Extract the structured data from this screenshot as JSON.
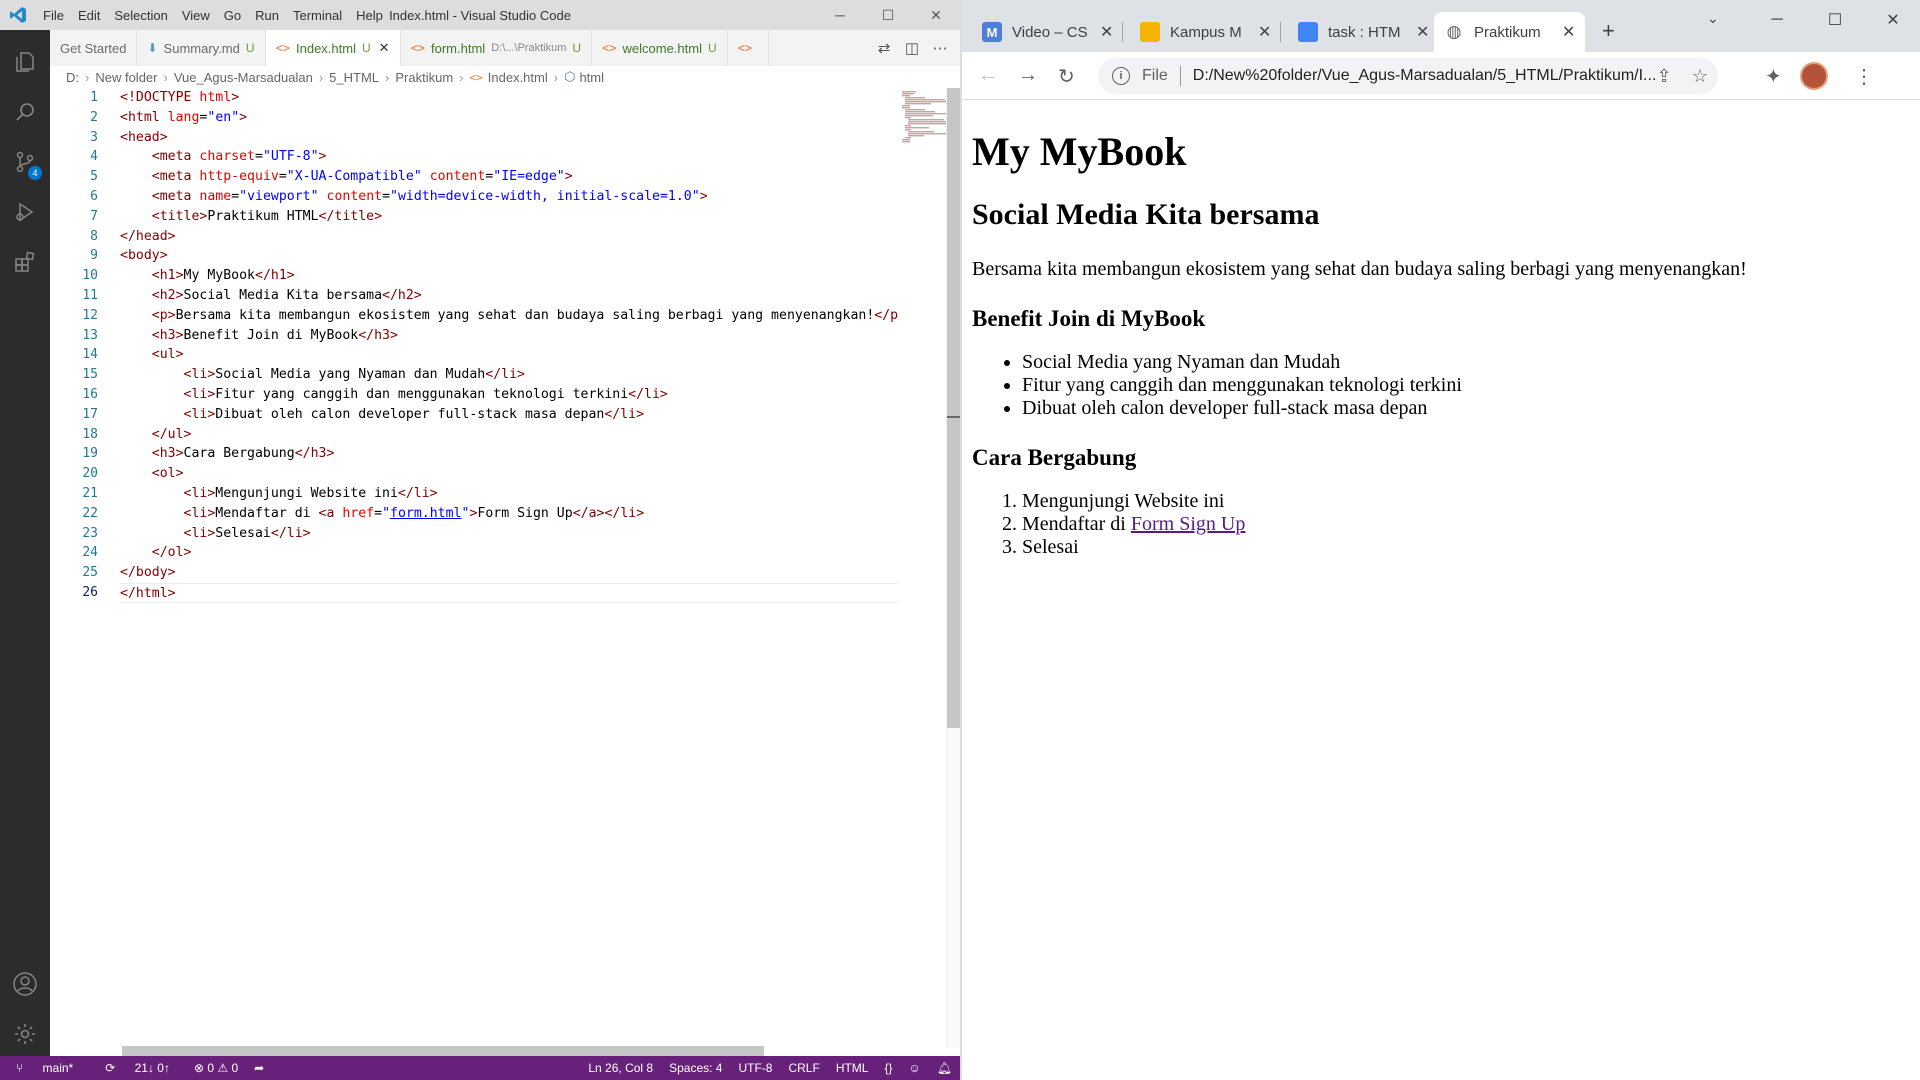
{
  "vscode": {
    "menu": [
      "File",
      "Edit",
      "Selection",
      "View",
      "Go",
      "Run",
      "Terminal",
      "Help"
    ],
    "window_title": "Index.html - Visual Studio Code",
    "tabs": [
      {
        "label": "Get Started",
        "badge": ""
      },
      {
        "label": "Summary.md",
        "badge": "U"
      },
      {
        "label": "Index.html",
        "badge": "U"
      },
      {
        "label": "form.html",
        "path": "D:\\...\\Praktikum",
        "badge": "U"
      },
      {
        "label": "welcome.html",
        "badge": "U"
      }
    ],
    "breadcrumb": [
      "D:",
      "New folder",
      "Vue_Agus-Marsadualan",
      "5_HTML",
      "Praktikum",
      "Index.html",
      "html"
    ],
    "scm_badge": "4",
    "line_numbers": [
      "1",
      "2",
      "3",
      "4",
      "5",
      "6",
      "7",
      "8",
      "9",
      "10",
      "11",
      "12",
      "13",
      "14",
      "15",
      "16",
      "17",
      "18",
      "19",
      "20",
      "21",
      "22",
      "23",
      "24",
      "25",
      "26"
    ],
    "status": {
      "branch": "main*",
      "sync": "21↓ 0↑",
      "problems": "⊗ 0 ⚠ 0",
      "position": "Ln 26, Col 8",
      "spaces": "Spaces: 4",
      "encoding": "UTF-8",
      "eol": "CRLF",
      "language": "HTML"
    }
  },
  "chrome": {
    "tabs": [
      {
        "title": "Video – CS",
        "icon_color": "#4e7fd8",
        "icon_letter": "M"
      },
      {
        "title": "Kampus M",
        "icon_color": "#f4b400",
        "icon_letter": ""
      },
      {
        "title": "task : HTM",
        "icon_color": "#4285f4",
        "icon_letter": ""
      },
      {
        "title": "Praktikum",
        "icon_color": "",
        "icon_letter": ""
      }
    ],
    "scheme": "File",
    "url": "D:/New%20folder/Vue_Agus-Marsadualan/5_HTML/Praktikum/I...",
    "page": {
      "h1": "My MyBook",
      "h2": "Social Media Kita bersama",
      "p": "Bersama kita membangun ekosistem yang sehat dan budaya saling berbagi yang menyenangkan!",
      "h3a": "Benefit Join di MyBook",
      "ul": [
        "Social Media yang Nyaman dan Mudah",
        "Fitur yang canggih dan menggunakan teknologi terkini",
        "Dibuat oleh calon developer full-stack masa depan"
      ],
      "h3b": "Cara Bergabung",
      "ol1": "Mengunjungi Website ini",
      "ol2_prefix": "Mendaftar di ",
      "ol2_link": "Form Sign Up",
      "ol3": "Selesai"
    }
  }
}
